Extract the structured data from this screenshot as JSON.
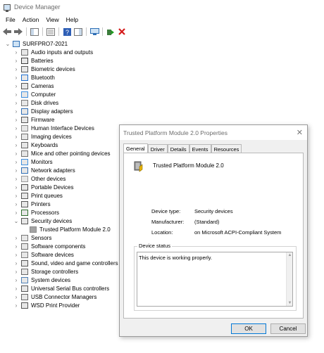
{
  "window": {
    "title": "Device Manager"
  },
  "menu": [
    "File",
    "Action",
    "View",
    "Help"
  ],
  "tree": {
    "root": "SURFPRO7-2021",
    "items": [
      "Audio inputs and outputs",
      "Batteries",
      "Biometric devices",
      "Bluetooth",
      "Cameras",
      "Computer",
      "Disk drives",
      "Display adapters",
      "Firmware",
      "Human Interface Devices",
      "Imaging devices",
      "Keyboards",
      "Mice and other pointing devices",
      "Monitors",
      "Network adapters",
      "Other devices",
      "Portable Devices",
      "Print queues",
      "Printers",
      "Processors",
      "Security devices",
      "Trusted Platform Module 2.0",
      "Sensors",
      "Software components",
      "Software devices",
      "Sound, video and game controllers",
      "Storage controllers",
      "System devices",
      "Universal Serial Bus controllers",
      "USB Connector Managers",
      "WSD Print Provider"
    ]
  },
  "dialog": {
    "title": "Trusted Platform Module 2.0 Properties",
    "tabs": [
      "General",
      "Driver",
      "Details",
      "Events",
      "Resources"
    ],
    "device_name": "Trusted Platform Module 2.0",
    "labels": {
      "device_type": "Device type:",
      "manufacturer": "Manufacturer:",
      "location": "Location:"
    },
    "values": {
      "device_type": "Security devices",
      "manufacturer": "(Standard)",
      "location": "on Microsoft ACPI-Compliant System"
    },
    "status_group_label": "Device status",
    "status_text": "This device is working properly.",
    "ok_label": "OK",
    "cancel_label": "Cancel"
  }
}
